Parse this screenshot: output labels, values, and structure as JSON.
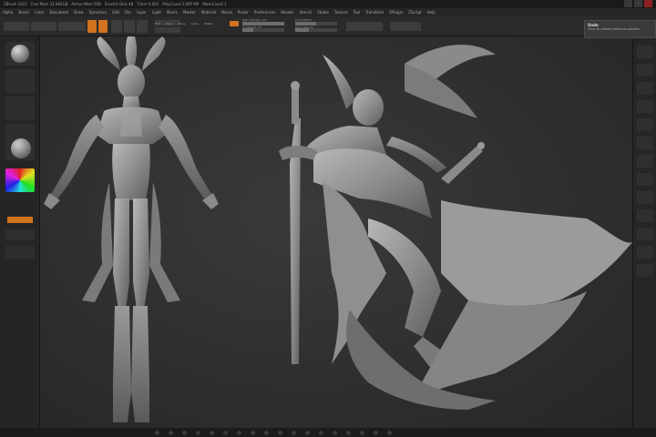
{
  "window": {
    "title_segments": [
      "ZBrush 2022",
      "Free Mem 31.982GB",
      "Active Mem 958",
      "Scratch Disk 48",
      "Timer 0.001",
      "PolyCount 2.095 MP",
      "MeshCount 1"
    ]
  },
  "menubar": {
    "items": [
      "Alpha",
      "Brush",
      "Color",
      "Document",
      "Draw",
      "Dynamics",
      "Edit",
      "File",
      "Layer",
      "Light",
      "Macro",
      "Marker",
      "Material",
      "Movie",
      "Picker",
      "Preferences",
      "Render",
      "Stencil",
      "Stroke",
      "Texture",
      "Tool",
      "Transform",
      "ZPlugin",
      "ZScript",
      "Help"
    ]
  },
  "shelf": {
    "labels": [
      "Edit",
      "Draw",
      "Move",
      "Scale",
      "Rotate"
    ],
    "focal_label": "Focal Shift 0",
    "draw_size_label": "Draw Size 64",
    "rgb_label": "Rgb Intensity 100",
    "z_label": "Z Intensity 25"
  },
  "tooltip": {
    "title": "Undo",
    "description": "Click to restore previous position"
  },
  "colors": {
    "accent": "#d2731f",
    "close": "#8c2323"
  },
  "icons": [
    "window-minimize-icon",
    "window-maximize-icon",
    "window-close-icon"
  ]
}
